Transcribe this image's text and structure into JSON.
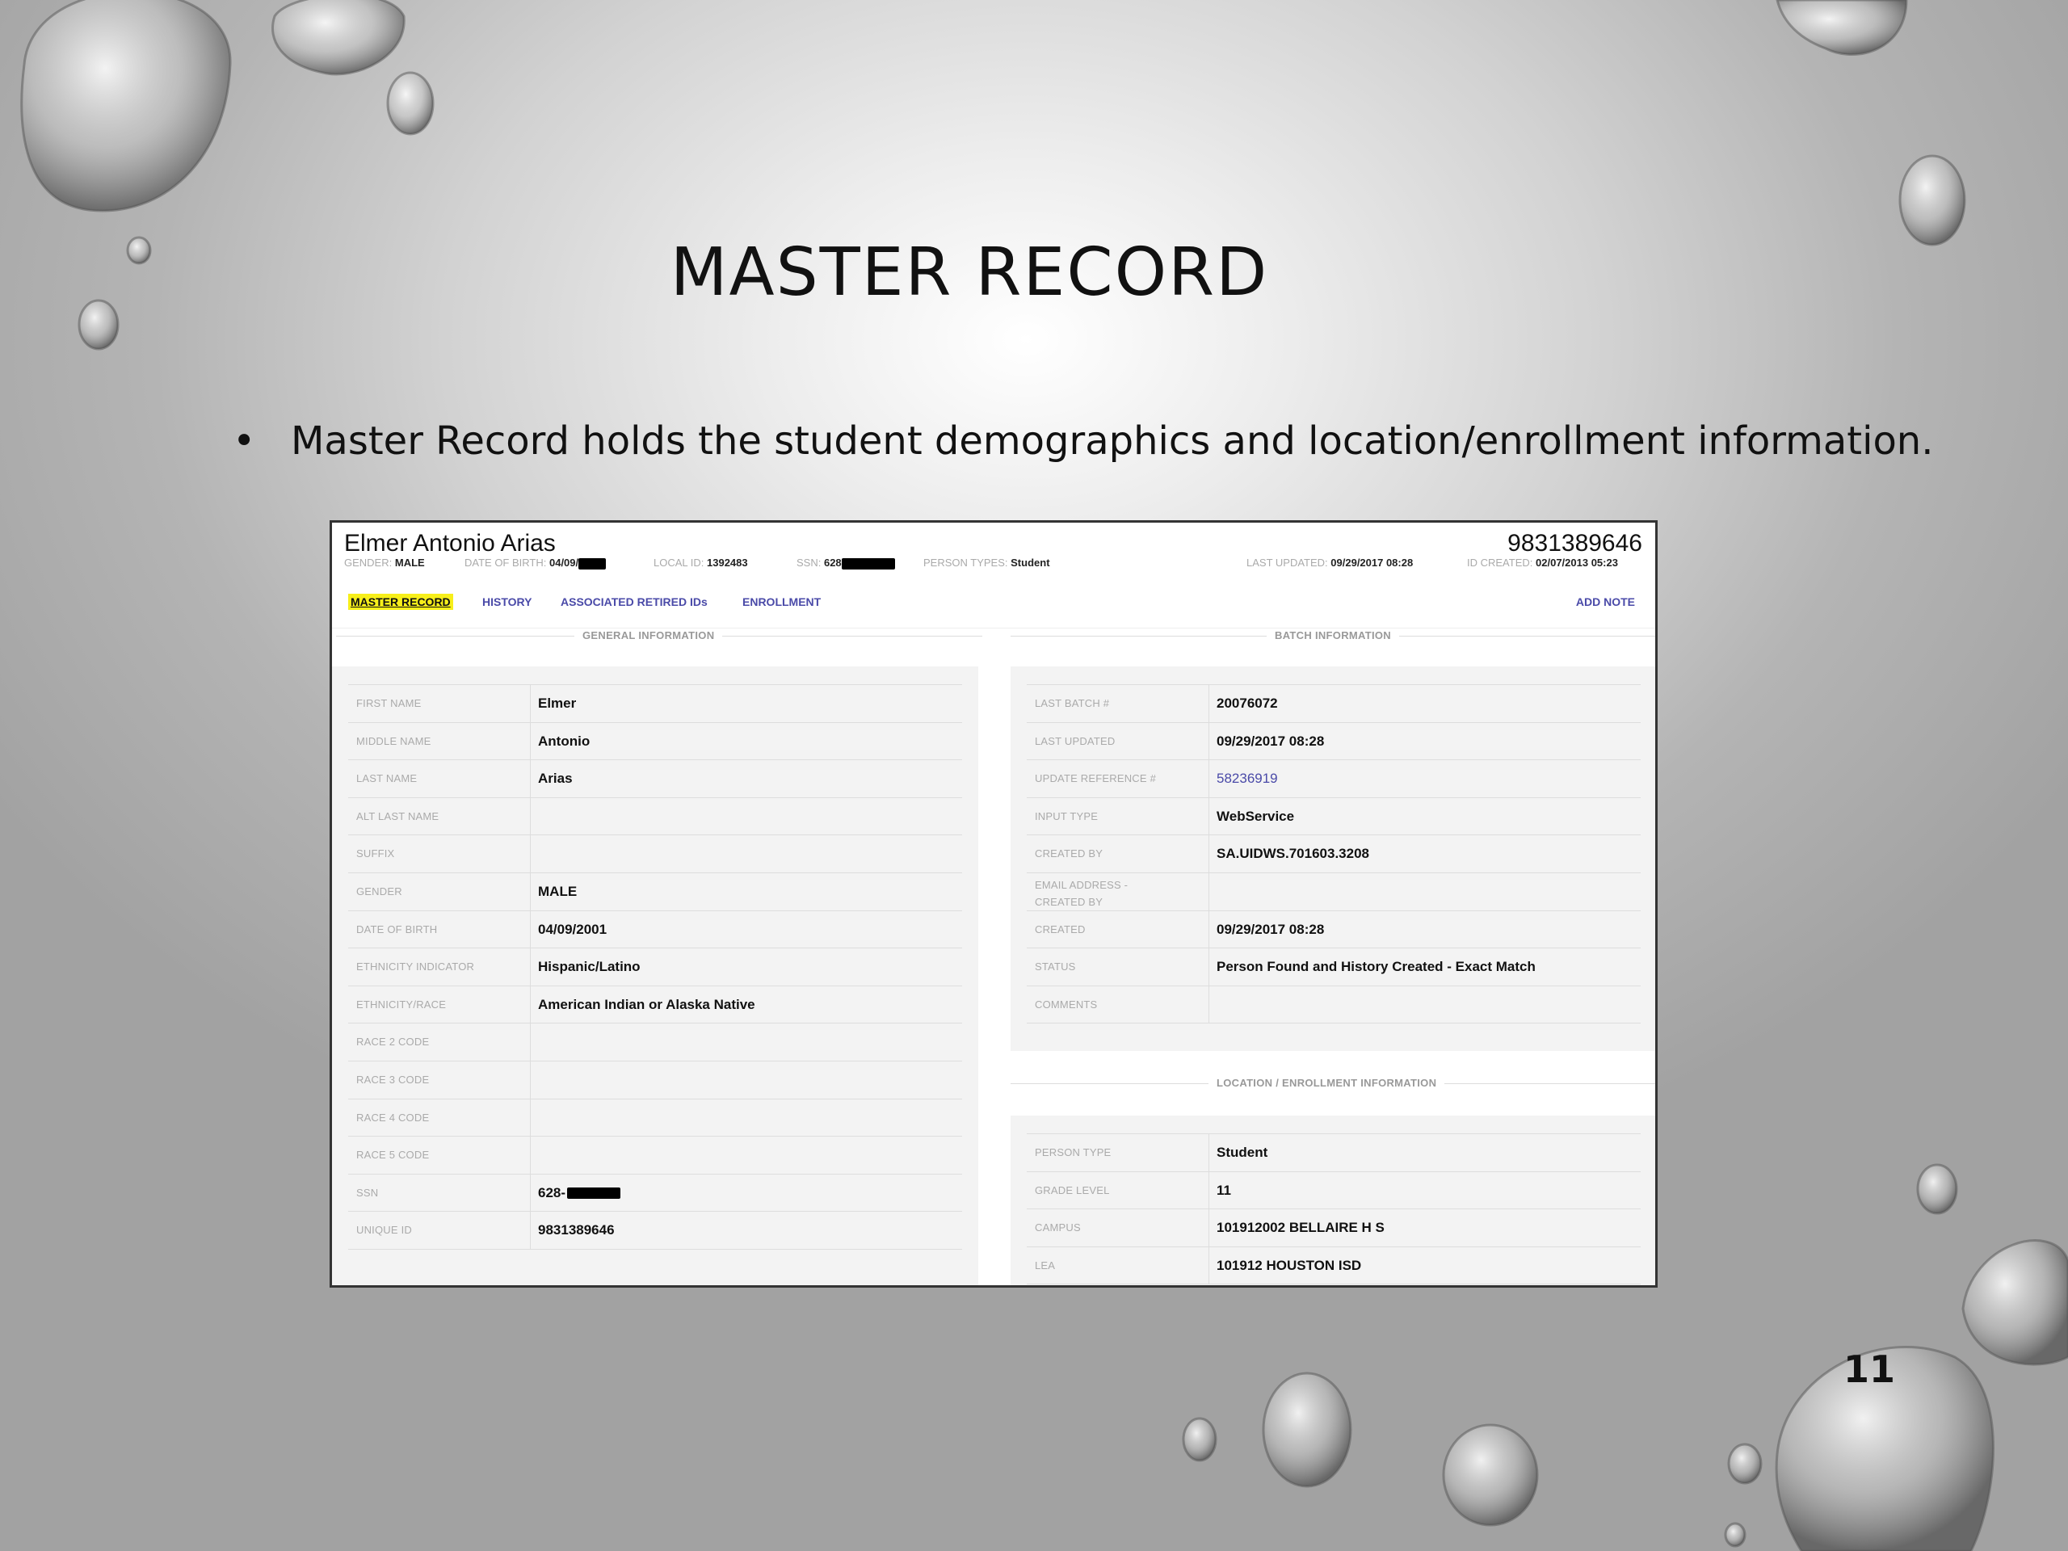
{
  "slide": {
    "title": "MASTER RECORD",
    "bullet_symbol": "•",
    "bullet_text": "Master Record holds the student demographics and location/enrollment information.",
    "slide_number": "11"
  },
  "record": {
    "name": "Elmer Antonio Arias",
    "unique_id": "9831389646",
    "meta": {
      "gender_label": "GENDER:",
      "gender_value": "MALE",
      "dob_label": "DATE OF BIRTH:",
      "dob_value": "04/09/",
      "local_id_label": "LOCAL ID:",
      "local_id_value": "1392483",
      "ssn_label": "SSN:",
      "ssn_value": "628",
      "person_types_label": "PERSON TYPES:",
      "person_types_value": "Student",
      "last_updated_label": "LAST UPDATED:",
      "last_updated_value": "09/29/2017 08:28",
      "id_created_label": "ID CREATED:",
      "id_created_value": "02/07/2013 05:23"
    },
    "tabs": [
      {
        "label": "MASTER RECORD",
        "active": true
      },
      {
        "label": "HISTORY",
        "active": false
      },
      {
        "label": "ASSOCIATED RETIRED IDs",
        "active": false
      },
      {
        "label": "ENROLLMENT",
        "active": false
      }
    ],
    "add_note_label": "ADD NOTE",
    "general": {
      "heading": "GENERAL INFORMATION",
      "rows": [
        {
          "label": "FIRST NAME",
          "value": "Elmer"
        },
        {
          "label": "MIDDLE NAME",
          "value": "Antonio"
        },
        {
          "label": "LAST NAME",
          "value": "Arias"
        },
        {
          "label": "ALT LAST NAME",
          "value": ""
        },
        {
          "label": "SUFFIX",
          "value": ""
        },
        {
          "label": "GENDER",
          "value": "MALE"
        },
        {
          "label": "DATE OF BIRTH",
          "value": "04/09/2001"
        },
        {
          "label": "ETHNICITY INDICATOR",
          "value": "Hispanic/Latino"
        },
        {
          "label": "ETHNICITY/RACE",
          "value": "American Indian or Alaska Native"
        },
        {
          "label": "RACE 2 CODE",
          "value": ""
        },
        {
          "label": "RACE 3 CODE",
          "value": ""
        },
        {
          "label": "RACE 4 CODE",
          "value": ""
        },
        {
          "label": "RACE 5 CODE",
          "value": ""
        },
        {
          "label": "SSN",
          "value": "628-",
          "redacted": true
        },
        {
          "label": "UNIQUE ID",
          "value": "9831389646"
        }
      ]
    },
    "batch": {
      "heading": "BATCH INFORMATION",
      "rows": [
        {
          "label": "LAST BATCH #",
          "value": "20076072"
        },
        {
          "label": "LAST UPDATED",
          "value": "09/29/2017 08:28"
        },
        {
          "label": "UPDATE REFERENCE #",
          "value": "58236919",
          "link": true
        },
        {
          "label": "INPUT TYPE",
          "value": "WebService"
        },
        {
          "label": "CREATED BY",
          "value": "SA.UIDWS.701603.3208"
        },
        {
          "label": "EMAIL ADDRESS - CREATED BY",
          "value": ""
        },
        {
          "label": "CREATED",
          "value": "09/29/2017 08:28"
        },
        {
          "label": "STATUS",
          "value": "Person Found and History Created - Exact Match"
        },
        {
          "label": "COMMENTS",
          "value": ""
        }
      ]
    },
    "location": {
      "heading": "LOCATION / ENROLLMENT INFORMATION",
      "rows": [
        {
          "label": "PERSON TYPE",
          "value": "Student"
        },
        {
          "label": "GRADE LEVEL",
          "value": "11"
        },
        {
          "label": "CAMPUS",
          "value": "101912002 BELLAIRE H S"
        },
        {
          "label": "LEA",
          "value": "101912 HOUSTON ISD"
        }
      ]
    }
  }
}
